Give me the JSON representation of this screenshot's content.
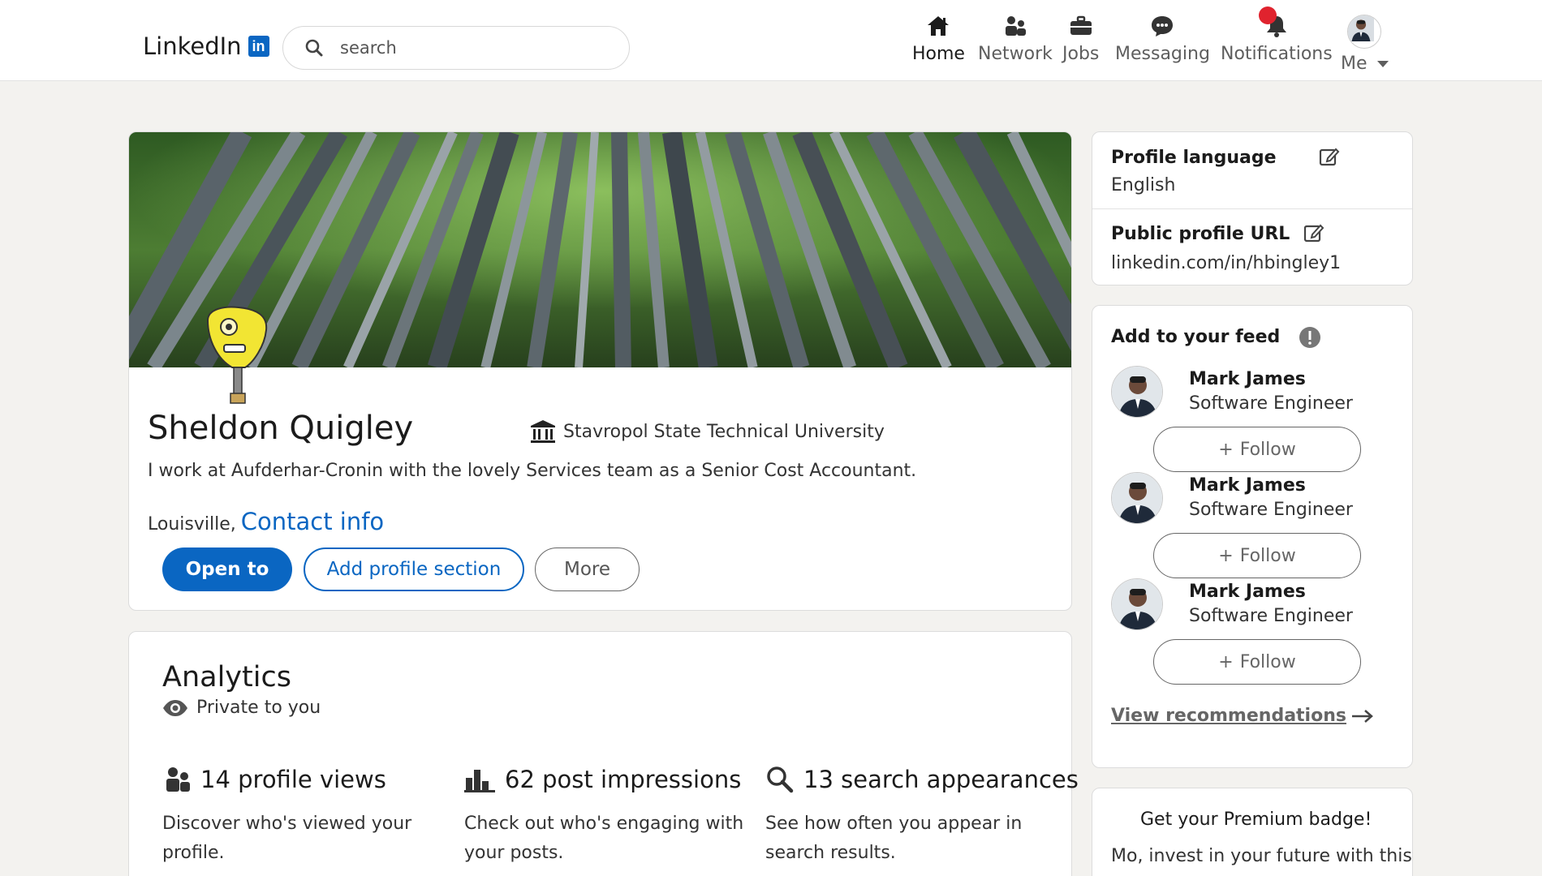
{
  "header": {
    "logo_text": "LinkedIn",
    "logo_badge": "in",
    "search_placeholder": "search",
    "nav": {
      "home": "Home",
      "network": "Network",
      "jobs": "Jobs",
      "messaging": "Messaging",
      "notifications": "Notifications",
      "me": "Me"
    },
    "accent_color": "#0a66c2",
    "notification_dot_color": "#e0232e"
  },
  "profile": {
    "name": "Sheldon Quigley",
    "university": "Stavropol State Technical University",
    "headline": "I work at Aufderhar-Cronin with the lovely Services team as a Senior Cost Accountant.",
    "location": "Louisville,",
    "contact_link": "Contact info",
    "buttons": {
      "open_to": "Open to",
      "add_section": "Add profile section",
      "more": "More"
    }
  },
  "analytics": {
    "title": "Analytics",
    "privacy": "Private to you",
    "metrics": [
      {
        "icon": "people-icon",
        "label": "14 profile views",
        "description_line1": "Discover who's viewed your",
        "description_line2": "profile."
      },
      {
        "icon": "bar-chart-icon",
        "label": "62 post impressions",
        "description_line1": "Check out who's engaging with",
        "description_line2": "your posts."
      },
      {
        "icon": "search-icon",
        "label": "13 search appearances",
        "description_line1": "See how often you appear in",
        "description_line2": "search results."
      }
    ]
  },
  "sidebar": {
    "profile_language_label": "Profile language",
    "profile_language_value": "English",
    "public_url_label": "Public profile URL",
    "public_url_value": "linkedin.com/in/hbingley1",
    "feed_title": "Add to your feed",
    "people": [
      {
        "name": "Mark James",
        "role": "Software Engineer",
        "follow": "Follow"
      },
      {
        "name": "Mark James",
        "role": "Software Engineer",
        "follow": "Follow"
      },
      {
        "name": "Mark James",
        "role": "Software Engineer",
        "follow": "Follow"
      }
    ],
    "view_recommendations": "View recommendations",
    "premium_title": "Get your Premium badge!",
    "premium_text": "Mo, invest in your future with this"
  }
}
